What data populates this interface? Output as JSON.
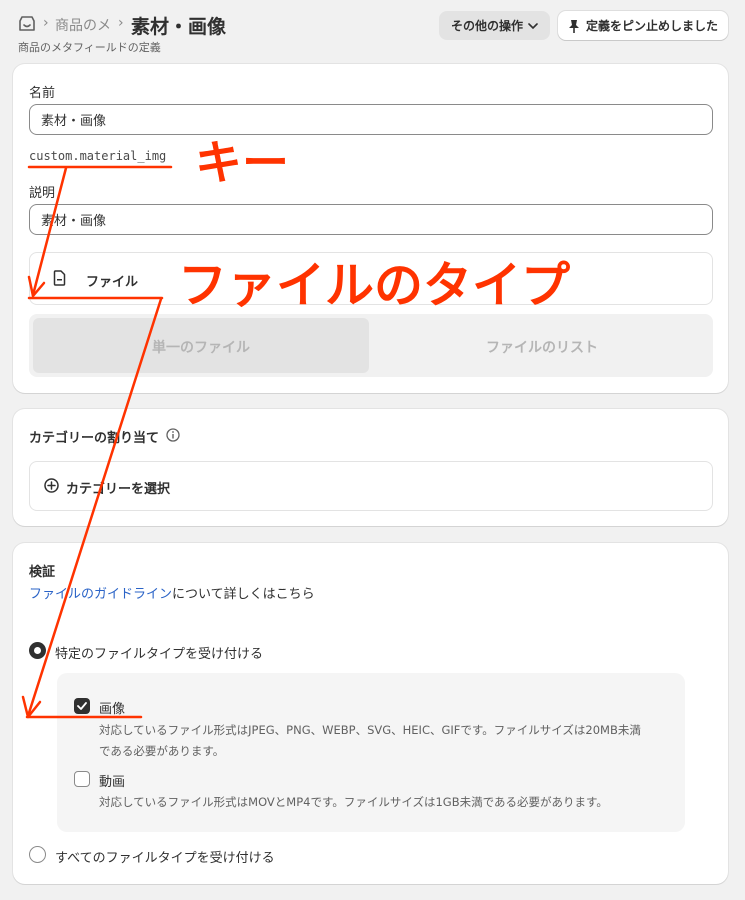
{
  "header": {
    "breadcrumb_parent": "商品のメ",
    "breadcrumb_sep": "›",
    "title": "素材・画像",
    "subtitle": "商品のメタフィールドの定義",
    "more_actions_label": "その他の操作",
    "pin_label": "定義をピン止めしました"
  },
  "definition": {
    "name_label": "名前",
    "name_value": "素材・画像",
    "key_value": "custom.material_img",
    "description_label": "説明",
    "description_value": "素材・画像",
    "type_label": "ファイル",
    "segments": [
      "単一のファイル",
      "ファイルのリスト"
    ]
  },
  "category": {
    "heading": "カテゴリーの割り当て",
    "select_label": "カテゴリーを選択"
  },
  "validation": {
    "heading": "検証",
    "guide_link": "ファイルのガイドライン",
    "guide_suffix": "について詳しくはこちら",
    "radio_specific": "特定のファイルタイプを受け付ける",
    "image_label": "画像",
    "image_hint_1": "対応しているファイル形式はJPEG、PNG、WEBP、SVG、HEIC、GIFです。ファイルサイズは20MB未満",
    "image_hint_2": "である必要があります。",
    "video_label": "動画",
    "video_hint": "対応しているファイル形式はMOVとMP4です。ファイルサイズは1GB未満である必要があります。",
    "radio_all": "すべてのファイルタイプを受け付ける"
  },
  "annotations": {
    "key": "キー",
    "file_type": "ファイルのタイプ",
    "color": "#ff3300"
  }
}
